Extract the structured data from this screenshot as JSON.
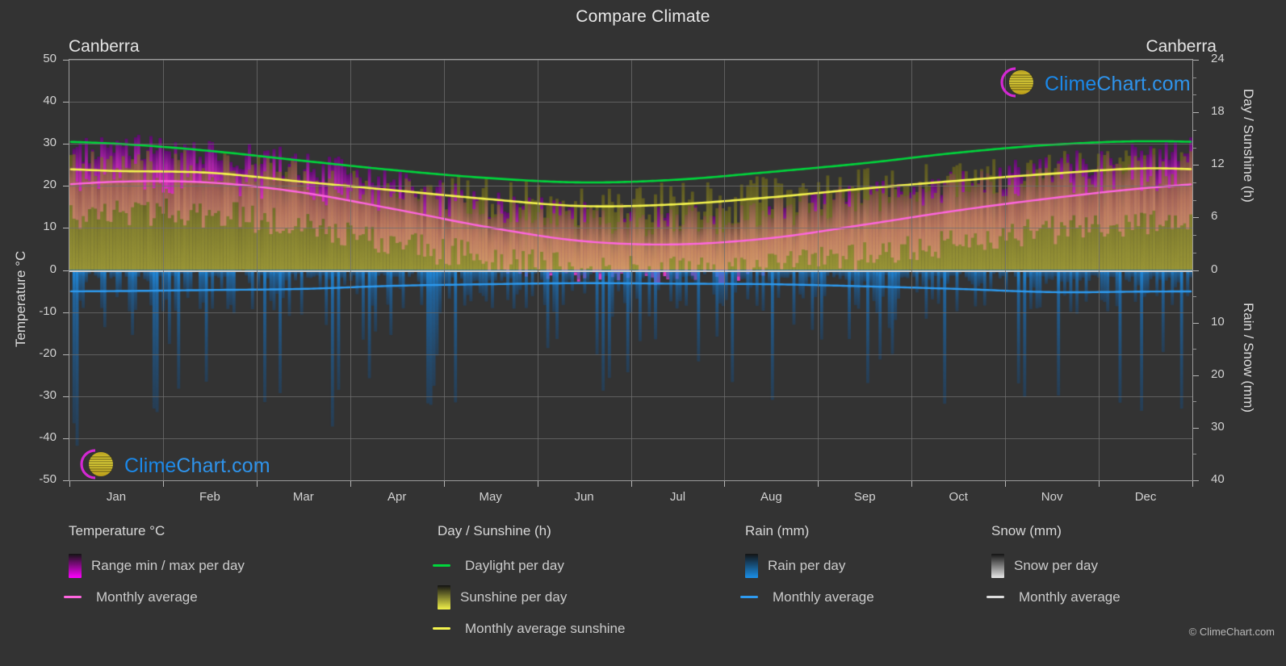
{
  "header": {
    "title": "Compare Climate",
    "city_left": "Canberra",
    "city_right": "Canberra"
  },
  "branding": {
    "wordmark_a": "Clime",
    "wordmark_b": "Chart.com",
    "copyright": "© ClimeChart.com"
  },
  "axes": {
    "y_left_title": "Temperature °C",
    "y_right_top_title": "Day / Sunshine (h)",
    "y_right_bottom_title": "Rain / Snow (mm)",
    "y_left_ticks": [
      "50",
      "40",
      "30",
      "20",
      "10",
      "0",
      "-10",
      "-20",
      "-30",
      "-40",
      "-50"
    ],
    "y_right_top_ticks": [
      "24",
      "18",
      "12",
      "6",
      "0"
    ],
    "y_right_bottom_ticks": [
      "10",
      "20",
      "30",
      "40"
    ],
    "x_ticks": [
      "Jan",
      "Feb",
      "Mar",
      "Apr",
      "May",
      "Jun",
      "Jul",
      "Aug",
      "Sep",
      "Oct",
      "Nov",
      "Dec"
    ]
  },
  "legend": {
    "groups": [
      {
        "title": "Temperature °C",
        "items": [
          {
            "label": "Range min / max per day",
            "marker": "gradient-swatch",
            "color": "#ff00ff"
          },
          {
            "label": "Monthly average",
            "marker": "line-dash",
            "color": "#ff66e0"
          }
        ]
      },
      {
        "title": "Day / Sunshine (h)",
        "items": [
          {
            "label": "Daylight per day",
            "marker": "line-dash",
            "color": "#00d63c"
          },
          {
            "label": "Sunshine per day",
            "marker": "gradient-swatch",
            "color": "#f2f24a"
          },
          {
            "label": "Monthly average sunshine",
            "marker": "line-dash",
            "color": "#f4f44e"
          }
        ]
      },
      {
        "title": "Rain (mm)",
        "items": [
          {
            "label": "Rain per day",
            "marker": "gradient-swatch",
            "color": "#1a8fe8"
          },
          {
            "label": "Monthly average",
            "marker": "line-dash",
            "color": "#2e9bf0"
          }
        ]
      },
      {
        "title": "Snow (mm)",
        "items": [
          {
            "label": "Snow per day",
            "marker": "gradient-swatch",
            "color": "#e8e8e8"
          },
          {
            "label": "Monthly average",
            "marker": "line-dash",
            "color": "#dddddd"
          }
        ]
      }
    ]
  },
  "chart_data": {
    "type": "line",
    "title": "Compare Climate",
    "location": "Canberra",
    "xlabel": "",
    "ylabel": "Temperature °C",
    "y2label_top": "Day / Sunshine (h)",
    "y2label_bottom": "Rain / Snow (mm)",
    "ylim": [
      -50,
      50
    ],
    "y2lim_top": [
      0,
      24
    ],
    "y2lim_bottom": [
      0,
      40
    ],
    "grid": true,
    "legend_position": "below",
    "categories": [
      "Jan",
      "Feb",
      "Mar",
      "Apr",
      "May",
      "Jun",
      "Jul",
      "Aug",
      "Sep",
      "Oct",
      "Nov",
      "Dec"
    ],
    "series": [
      {
        "name": "Daylight per day",
        "unit": "h",
        "axis": "right-top",
        "color": "#00d63c",
        "values": [
          14.4,
          13.6,
          12.5,
          11.4,
          10.5,
          10.0,
          10.3,
          11.2,
          12.2,
          13.4,
          14.3,
          14.7
        ]
      },
      {
        "name": "Monthly average sunshine",
        "unit": "h",
        "axis": "right-top",
        "color": "#f4f44e",
        "values": [
          11.3,
          11.1,
          10.1,
          9.1,
          8.1,
          7.3,
          7.5,
          8.3,
          9.3,
          10.2,
          11.0,
          11.6
        ]
      },
      {
        "name": "Monthly average temperature",
        "unit": "°C",
        "axis": "left",
        "color": "#ff66e0",
        "values": [
          21.0,
          20.8,
          18.5,
          14.5,
          10.2,
          6.9,
          6.1,
          7.6,
          10.8,
          14.2,
          17.1,
          19.5
        ]
      },
      {
        "name": "Rain monthly average",
        "unit": "mm",
        "axis": "right-bottom",
        "color": "#2e9bf0",
        "values": [
          4.0,
          3.8,
          3.6,
          3.0,
          2.7,
          2.5,
          2.6,
          2.7,
          3.1,
          3.6,
          4.2,
          4.1
        ]
      }
    ],
    "bands": [
      {
        "name": "Range min / max per day (temperature)",
        "unit": "°C",
        "color": "#ff00ff",
        "min": [
          13.5,
          13.3,
          10.8,
          6.5,
          3.0,
          0.5,
          -0.2,
          0.8,
          3.5,
          6.5,
          9.5,
          11.8
        ],
        "max": [
          28.5,
          27.8,
          25.0,
          20.5,
          16.0,
          12.5,
          11.8,
          13.5,
          17.0,
          20.5,
          24.0,
          26.8
        ]
      },
      {
        "name": "Sunshine per day",
        "unit": "h",
        "color": "#d4d438",
        "min": [
          0,
          0,
          0,
          0,
          0,
          0,
          0,
          0,
          0,
          0,
          0,
          0
        ],
        "max": [
          14.2,
          13.4,
          12.3,
          11.2,
          10.4,
          9.9,
          10.2,
          11.0,
          12.0,
          13.2,
          14.1,
          14.5
        ]
      },
      {
        "name": "Rain per day",
        "unit": "mm",
        "color": "#1a8fe8",
        "min": [
          0,
          0,
          0,
          0,
          0,
          0,
          0,
          0,
          0,
          0,
          0,
          0
        ],
        "max": [
          36,
          30,
          34,
          28,
          26,
          24,
          22,
          24,
          30,
          33,
          38,
          35
        ]
      }
    ]
  }
}
